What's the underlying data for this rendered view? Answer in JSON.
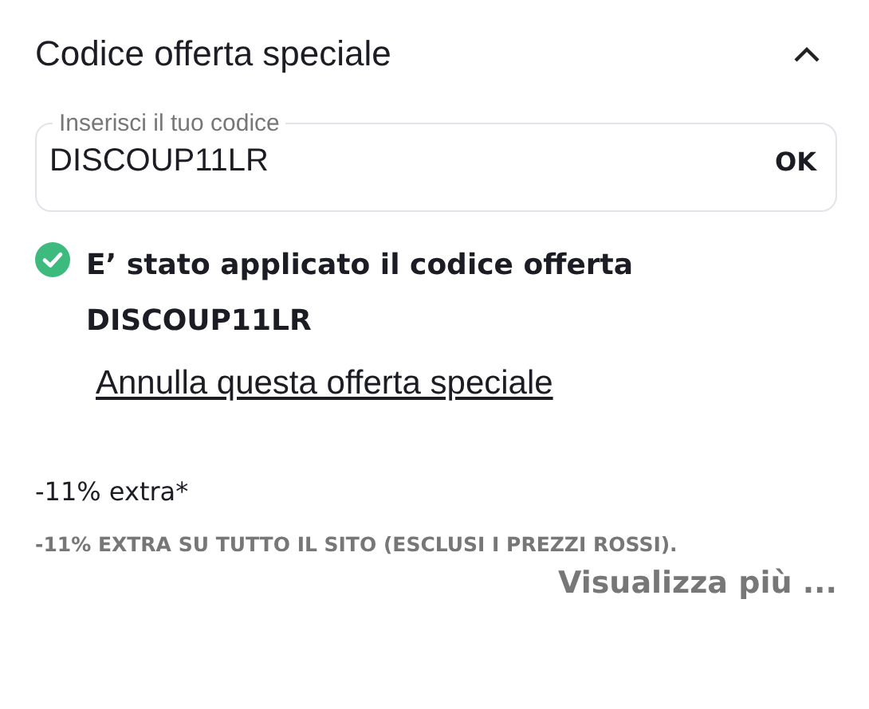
{
  "section": {
    "title": "Codice offerta speciale",
    "expanded": true
  },
  "code_field": {
    "label": "Inserisci il tuo codice",
    "value": "DISCOUP11LR",
    "button": "OK"
  },
  "success": {
    "message": "E’ stato applicato il codice offerta DISCOUP11LR"
  },
  "cancel_link": "Annulla questa offerta speciale",
  "offer": {
    "title": "-11% extra*",
    "description": "-11% EXTRA SU TUTTO IL SITO (ESCLUSI I PREZZI ROSSI).",
    "more": "Visualizza più ..."
  }
}
